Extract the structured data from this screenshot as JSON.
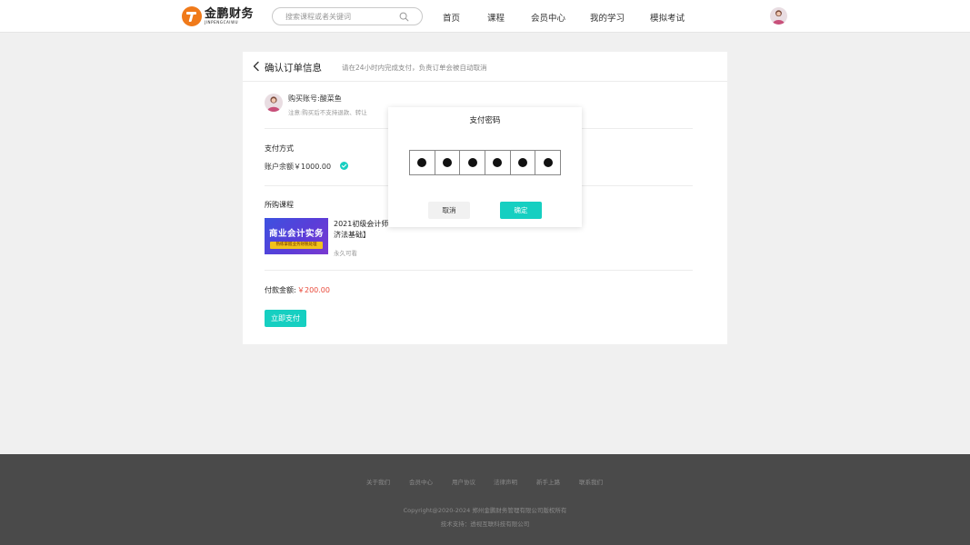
{
  "header": {
    "logo_cn": "金鹏财务",
    "logo_en": "JINPENGCAIWU",
    "search_placeholder": "搜索课程或者关键词",
    "nav": [
      "首页",
      "课程",
      "会员中心",
      "我的学习",
      "模拟考试"
    ]
  },
  "order": {
    "title": "确认订单信息",
    "tip": "请在24小时内完成支付，负责订单会被自动取消",
    "account_name": "购买账号:酸菜鱼",
    "account_note": "注意:购买后不支持退款、转让",
    "payment_label": "支付方式",
    "balance": "账户余额￥1000.00",
    "course_label": "所购课程",
    "course": {
      "thumb_title": "商业会计实务",
      "thumb_sub": "熟练掌握业务财税处理",
      "name_line1": "2021初级会计师【",
      "name_line2": "济法基础】",
      "validity": "永久可看"
    },
    "amount_label": "付款金额:",
    "amount": "￥200.00",
    "pay_button": "立即支付"
  },
  "modal": {
    "title": "支付密码",
    "digits_entered": 6,
    "cancel": "取消",
    "confirm": "确定"
  },
  "footer": {
    "links": [
      "关于我们",
      "会员中心",
      "用户协议",
      "法律声明",
      "新手上路",
      "联系我们"
    ],
    "copyright": "Copyright@2020-2024 郑州金鹏财务管理有限公司版权所有",
    "support": "技术支持：透视互联科技有限公司"
  },
  "colors": {
    "accent": "#16cfc1",
    "price": "#e94a3b",
    "logo": "#f07a1a",
    "footer_bg": "#4a4a4a"
  }
}
